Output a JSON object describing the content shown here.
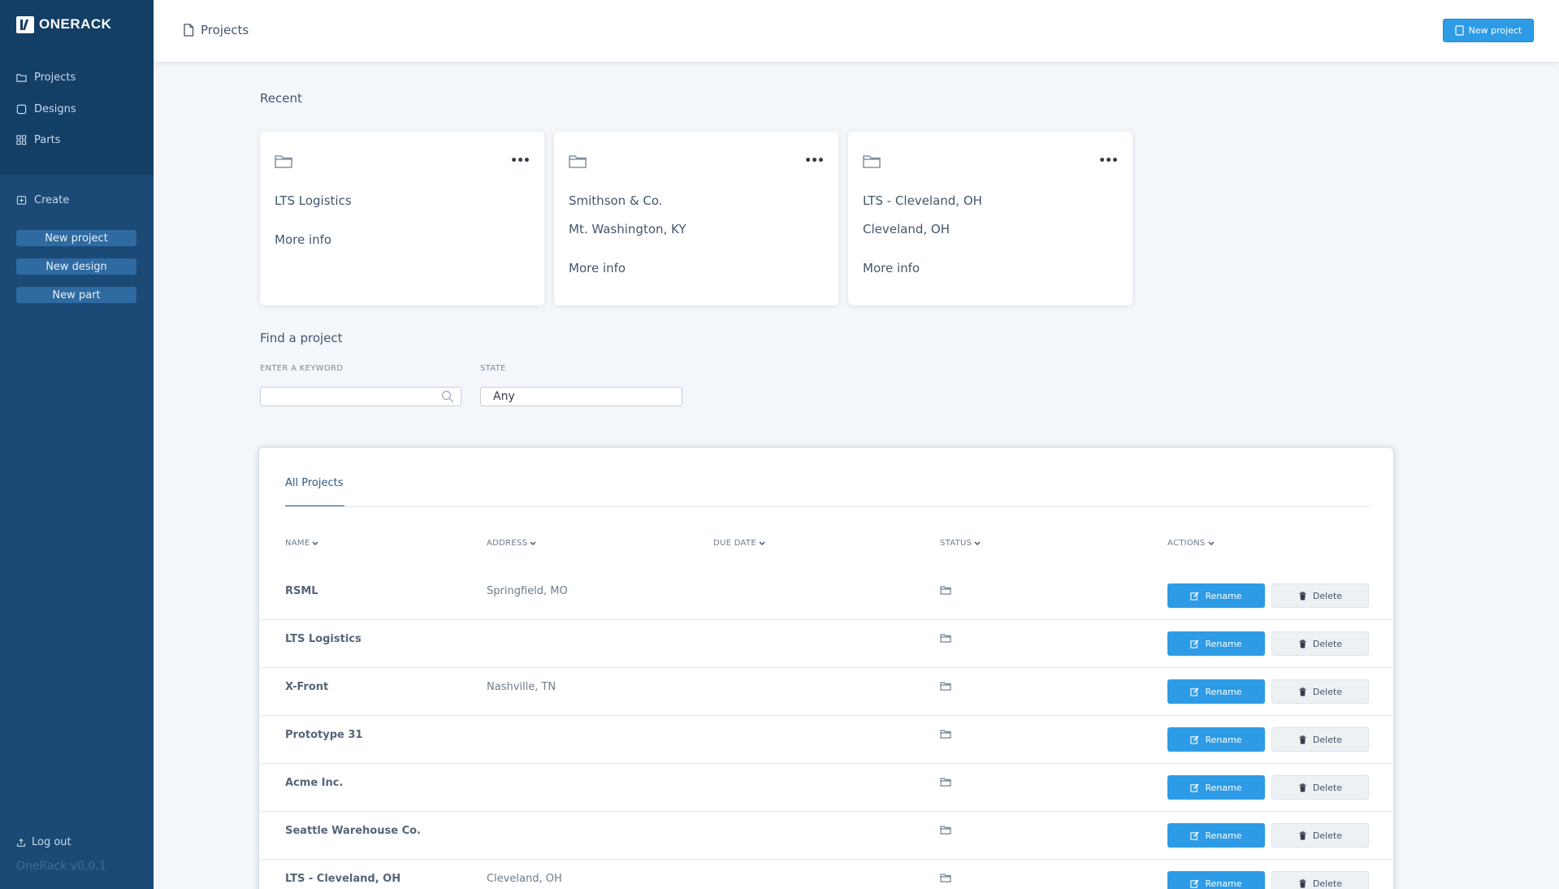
{
  "app": {
    "brand": "ONERACK",
    "version": "OneRack v0.0.1"
  },
  "sidebar": {
    "nav": [
      {
        "label": "Projects",
        "icon": "folder-icon"
      },
      {
        "label": "Designs",
        "icon": "square-icon"
      },
      {
        "label": "Parts",
        "icon": "grid-icon"
      }
    ],
    "create_label": "Create",
    "create_buttons": [
      "New project",
      "New design",
      "New part"
    ],
    "logout_label": "Log out"
  },
  "header": {
    "title": "Projects",
    "new_project_label": "New project"
  },
  "recent": {
    "title": "Recent",
    "cards": [
      {
        "name": "LTS Logistics",
        "location": "",
        "more": "More info"
      },
      {
        "name": "Smithson & Co.",
        "location": "Mt. Washington, KY",
        "more": "More info"
      },
      {
        "name": "LTS - Cleveland, OH",
        "location": "Cleveland, OH",
        "more": "More info"
      }
    ]
  },
  "find": {
    "title": "Find a project",
    "keyword_label": "ENTER A KEYWORD",
    "keyword_value": "",
    "state_label": "STATE",
    "state_value": "Any"
  },
  "table": {
    "tab": "All Projects",
    "columns": [
      "NAME",
      "ADDRESS",
      "DUE DATE",
      "STATUS",
      "ACTIONS"
    ],
    "rename_label": "Rename",
    "delete_label": "Delete",
    "rows": [
      {
        "name": "RSML",
        "address": "Springfield, MO",
        "due": ""
      },
      {
        "name": "LTS Logistics",
        "address": "",
        "due": ""
      },
      {
        "name": "X-Front",
        "address": "Nashville, TN",
        "due": ""
      },
      {
        "name": "Prototype 31",
        "address": "",
        "due": ""
      },
      {
        "name": "Acme Inc.",
        "address": "",
        "due": ""
      },
      {
        "name": "Seattle Warehouse Co.",
        "address": "",
        "due": ""
      },
      {
        "name": "LTS - Cleveland, OH",
        "address": "Cleveland, OH",
        "due": ""
      }
    ]
  },
  "colors": {
    "sidebar": "#1a4a75",
    "sidebar_top": "#133e66",
    "accent": "#2d9be6",
    "background": "#f3f6fa"
  }
}
